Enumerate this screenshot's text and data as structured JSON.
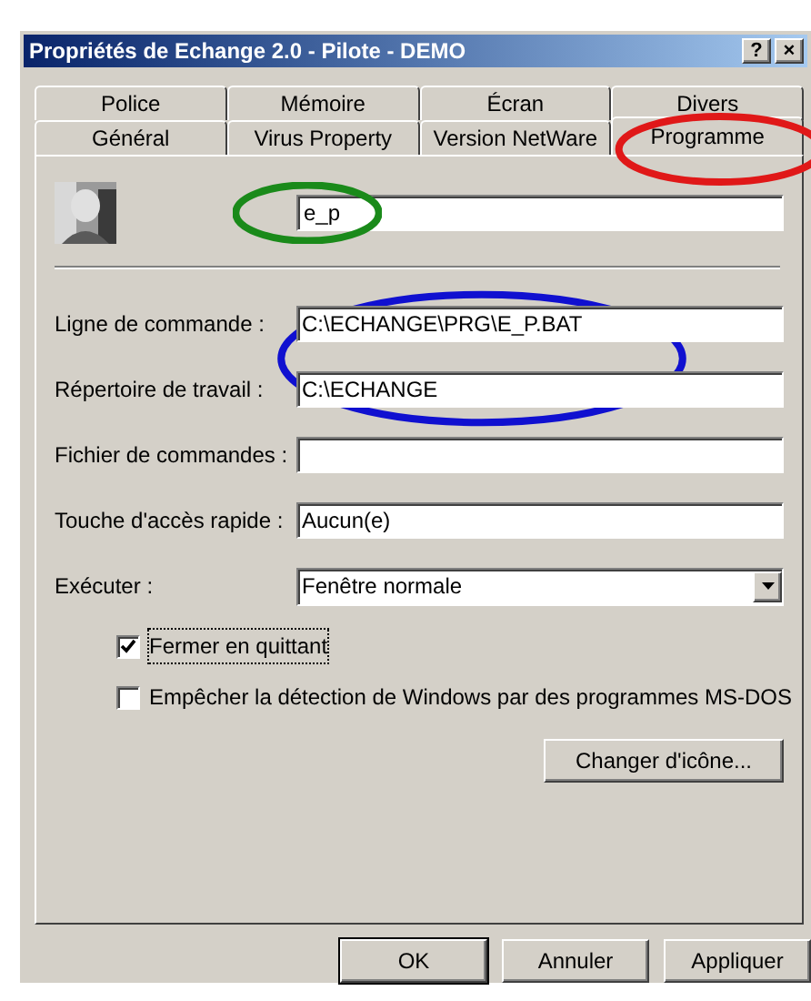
{
  "window": {
    "title": "Propriétés de Echange 2.0 - Pilote - DEMO",
    "title_buttons": [
      "?",
      "×"
    ]
  },
  "tab_rows": [
    [
      {
        "label": "Police",
        "selected": false
      },
      {
        "label": "Mémoire",
        "selected": false
      },
      {
        "label": "Écran",
        "selected": false
      },
      {
        "label": "Divers",
        "selected": false
      }
    ],
    [
      {
        "label": "Général",
        "selected": false
      },
      {
        "label": "Virus Property",
        "selected": false
      },
      {
        "label": "Version NetWare",
        "selected": false
      },
      {
        "label": "Programme",
        "selected": true
      }
    ]
  ],
  "program": {
    "name": "e_p"
  },
  "fields": [
    {
      "label": "Ligne de commande :",
      "value": "C:\\ECHANGE\\PRG\\E_P.BAT"
    },
    {
      "label": "Répertoire de travail :",
      "value": "C:\\ECHANGE"
    },
    {
      "label": "Fichier de commandes :"
    },
    {
      "label": "Touche d'accès rapide :",
      "value": "Aucun(e)"
    }
  ],
  "run": {
    "label": "Exécuter :",
    "value": "Fenêtre normale"
  },
  "checkboxes": [
    {
      "label": "Fermer en quittant",
      "checked": true,
      "focused": true
    },
    {
      "label": "Empêcher la détection de Windows par des programmes MS-DOS",
      "checked": false,
      "focused": false
    }
  ],
  "change_icon_button": "Changer d'icône...",
  "buttons": [
    {
      "label": "OK",
      "default": true
    },
    {
      "label": "Annuler",
      "default": false
    },
    {
      "label": "Appliquer",
      "default": false
    }
  ],
  "annotations": [
    {
      "kind": "tab",
      "color": "#e01818"
    },
    {
      "kind": "name",
      "color": "#1a8a1a"
    },
    {
      "kind": "paths",
      "color": "#1010d0"
    }
  ]
}
